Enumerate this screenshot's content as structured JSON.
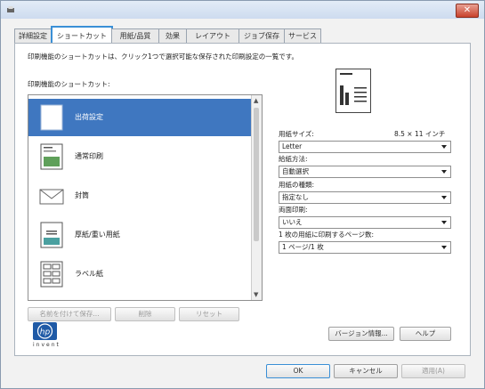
{
  "tabs": [
    "詳細設定",
    "ショートカット",
    "用紙/品質",
    "効果",
    "レイアウト",
    "ジョブ保存",
    "サービス"
  ],
  "active_tab": 1,
  "description": "印刷機能のショートカットは、クリック1つで選択可能な保存された印刷設定の一覧です。",
  "shortcuts_label": "印刷機能のショートカット:",
  "shortcuts": [
    {
      "label": "出荷設定",
      "icon": "default-page-icon",
      "selected": true
    },
    {
      "label": "通常印刷",
      "icon": "photo-page-icon",
      "selected": false
    },
    {
      "label": "封筒",
      "icon": "envelope-icon",
      "selected": false
    },
    {
      "label": "厚紙/重い用紙",
      "icon": "cardstock-page-icon",
      "selected": false
    },
    {
      "label": "ラベル紙",
      "icon": "labels-icon",
      "selected": false
    }
  ],
  "list_buttons": {
    "save_as": "名前を付けて保存...",
    "delete": "削除",
    "reset": "リセット"
  },
  "paper_size": {
    "label": "用紙サイズ:",
    "value_text": "8.5 × 11 インチ",
    "selected": "Letter"
  },
  "paper_source": {
    "label": "給紙方法:",
    "selected": "自動選択"
  },
  "paper_type": {
    "label": "用紙の種類:",
    "selected": "指定なし"
  },
  "duplex": {
    "label": "両面印刷:",
    "selected": "いいえ"
  },
  "pages_per_sheet": {
    "label": "1 枚の用紙に印刷するページ数:",
    "selected": "1 ページ/1 枚"
  },
  "logo_text": "invent",
  "version_button": "バージョン情報...",
  "help_button": "ヘルプ",
  "ok_button": "OK",
  "cancel_button": "キャンセル",
  "apply_button": "適用(A)",
  "colors": {
    "tab_active_border": "#3a8fd6",
    "selection": "#3f77c0",
    "close": "#c8412c"
  }
}
